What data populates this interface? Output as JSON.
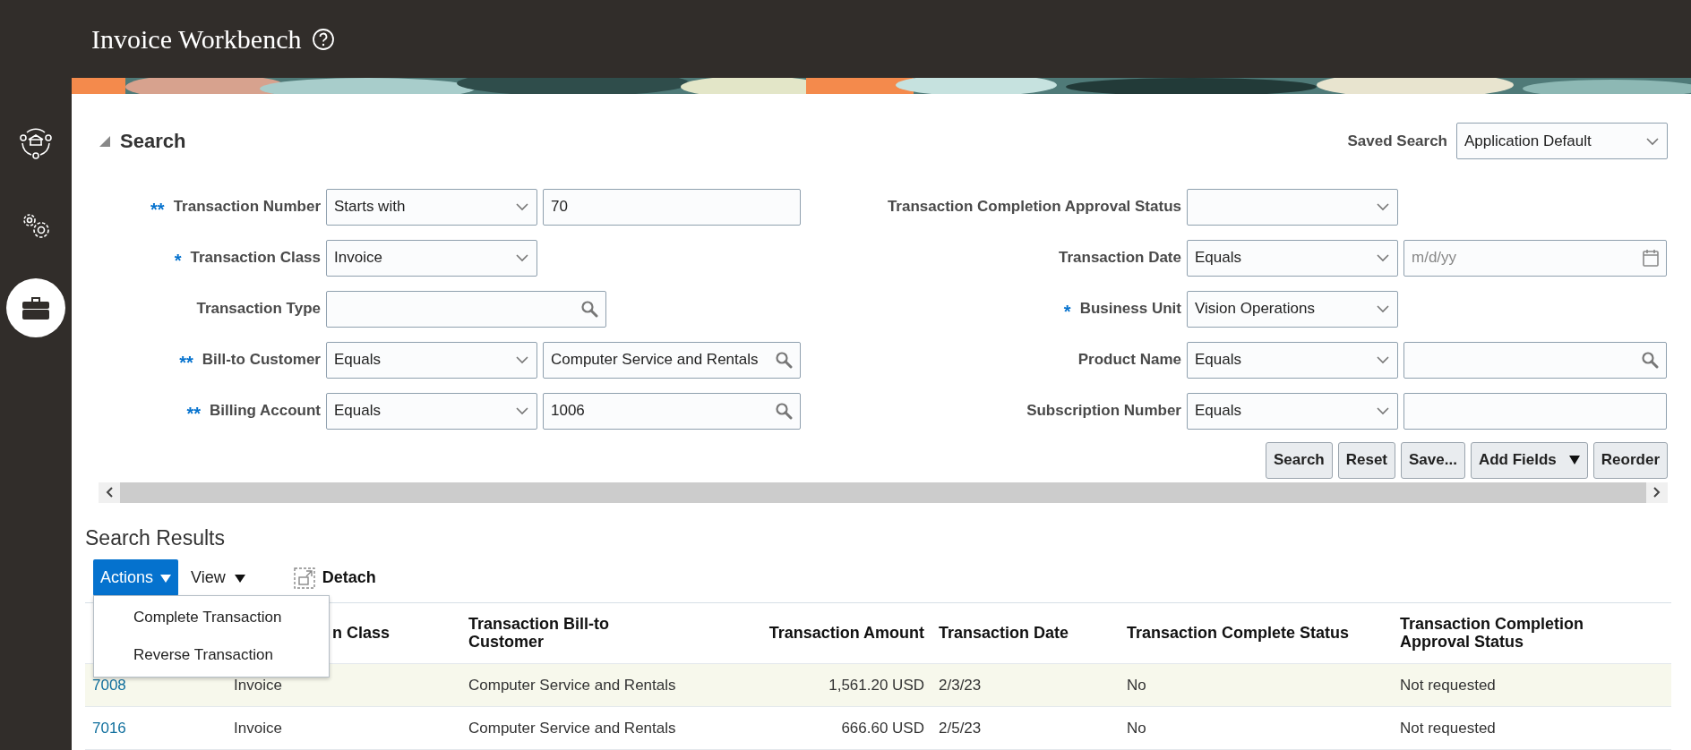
{
  "header": {
    "title": "Invoice Workbench"
  },
  "sidebar": {
    "items": [
      {
        "kind": "cycle",
        "selected": false
      },
      {
        "kind": "gears",
        "selected": false
      },
      {
        "kind": "toolbox",
        "selected": true
      }
    ]
  },
  "search": {
    "title": "Search",
    "expanded": true,
    "saved_search": {
      "label": "Saved Search",
      "value": "Application Default"
    },
    "left_fields": [
      {
        "marker": "**",
        "label": "Transaction Number",
        "operator": "Starts with",
        "control": {
          "kind": "text",
          "value": "70"
        }
      },
      {
        "marker": "*",
        "label": "Transaction Class",
        "control": {
          "kind": "select",
          "value": "Invoice"
        }
      },
      {
        "label": "Transaction Type",
        "control": {
          "kind": "lookup"
        }
      },
      {
        "marker": "**",
        "label": "Bill-to Customer",
        "operator": "Equals",
        "control": {
          "kind": "lookup",
          "value": "Computer Service and Rentals"
        }
      },
      {
        "marker": "**",
        "label": "Billing Account",
        "operator": "Equals",
        "control": {
          "kind": "lookup",
          "value": "1006"
        }
      }
    ],
    "right_fields": [
      {
        "label": "Transaction Completion Approval Status",
        "control": {
          "kind": "select"
        }
      },
      {
        "label": "Transaction Date",
        "operator": "Equals",
        "control": {
          "kind": "date",
          "placeholder": "m/d/yy"
        }
      },
      {
        "marker": "*",
        "label": "Business Unit",
        "control": {
          "kind": "select",
          "value": "Vision Operations"
        }
      },
      {
        "label": "Product Name",
        "operator": "Equals",
        "control": {
          "kind": "lookup"
        }
      },
      {
        "label": "Subscription Number",
        "operator": "Equals",
        "control": {
          "kind": "text"
        }
      }
    ],
    "buttons": [
      {
        "label": "Search",
        "kind": "plain"
      },
      {
        "label": "Reset",
        "kind": "plain"
      },
      {
        "label": "Save...",
        "kind": "plain"
      },
      {
        "label": "Add Fields",
        "kind": "menu"
      },
      {
        "label": "Reorder",
        "kind": "plain"
      }
    ]
  },
  "results": {
    "title": "Search Results",
    "toolbar": {
      "actions": "Actions",
      "view": "View",
      "detach": "Detach"
    },
    "actions_menu": {
      "items": [
        "Complete Transaction",
        "Reverse Transaction"
      ]
    },
    "table": {
      "columns": [
        {},
        {
          "label": "n Class"
        },
        {
          "label": "Transaction Bill-to Customer"
        },
        {
          "label": "Transaction Amount"
        },
        {
          "label": "Transaction Date"
        },
        {
          "label": "Transaction Complete Status"
        },
        {
          "label": "Transaction Completion Approval Status"
        }
      ],
      "rows": [
        {
          "selected": true,
          "cells": [
            "7008",
            "Invoice",
            "Computer Service and Rentals",
            "1,561.20 USD",
            "2/3/23",
            "No",
            "Not requested"
          ]
        },
        {
          "selected": false,
          "cells": [
            "7016",
            "Invoice",
            "Computer Service and Rentals",
            "666.60 USD",
            "2/5/23",
            "No",
            "Not requested"
          ]
        }
      ]
    }
  }
}
